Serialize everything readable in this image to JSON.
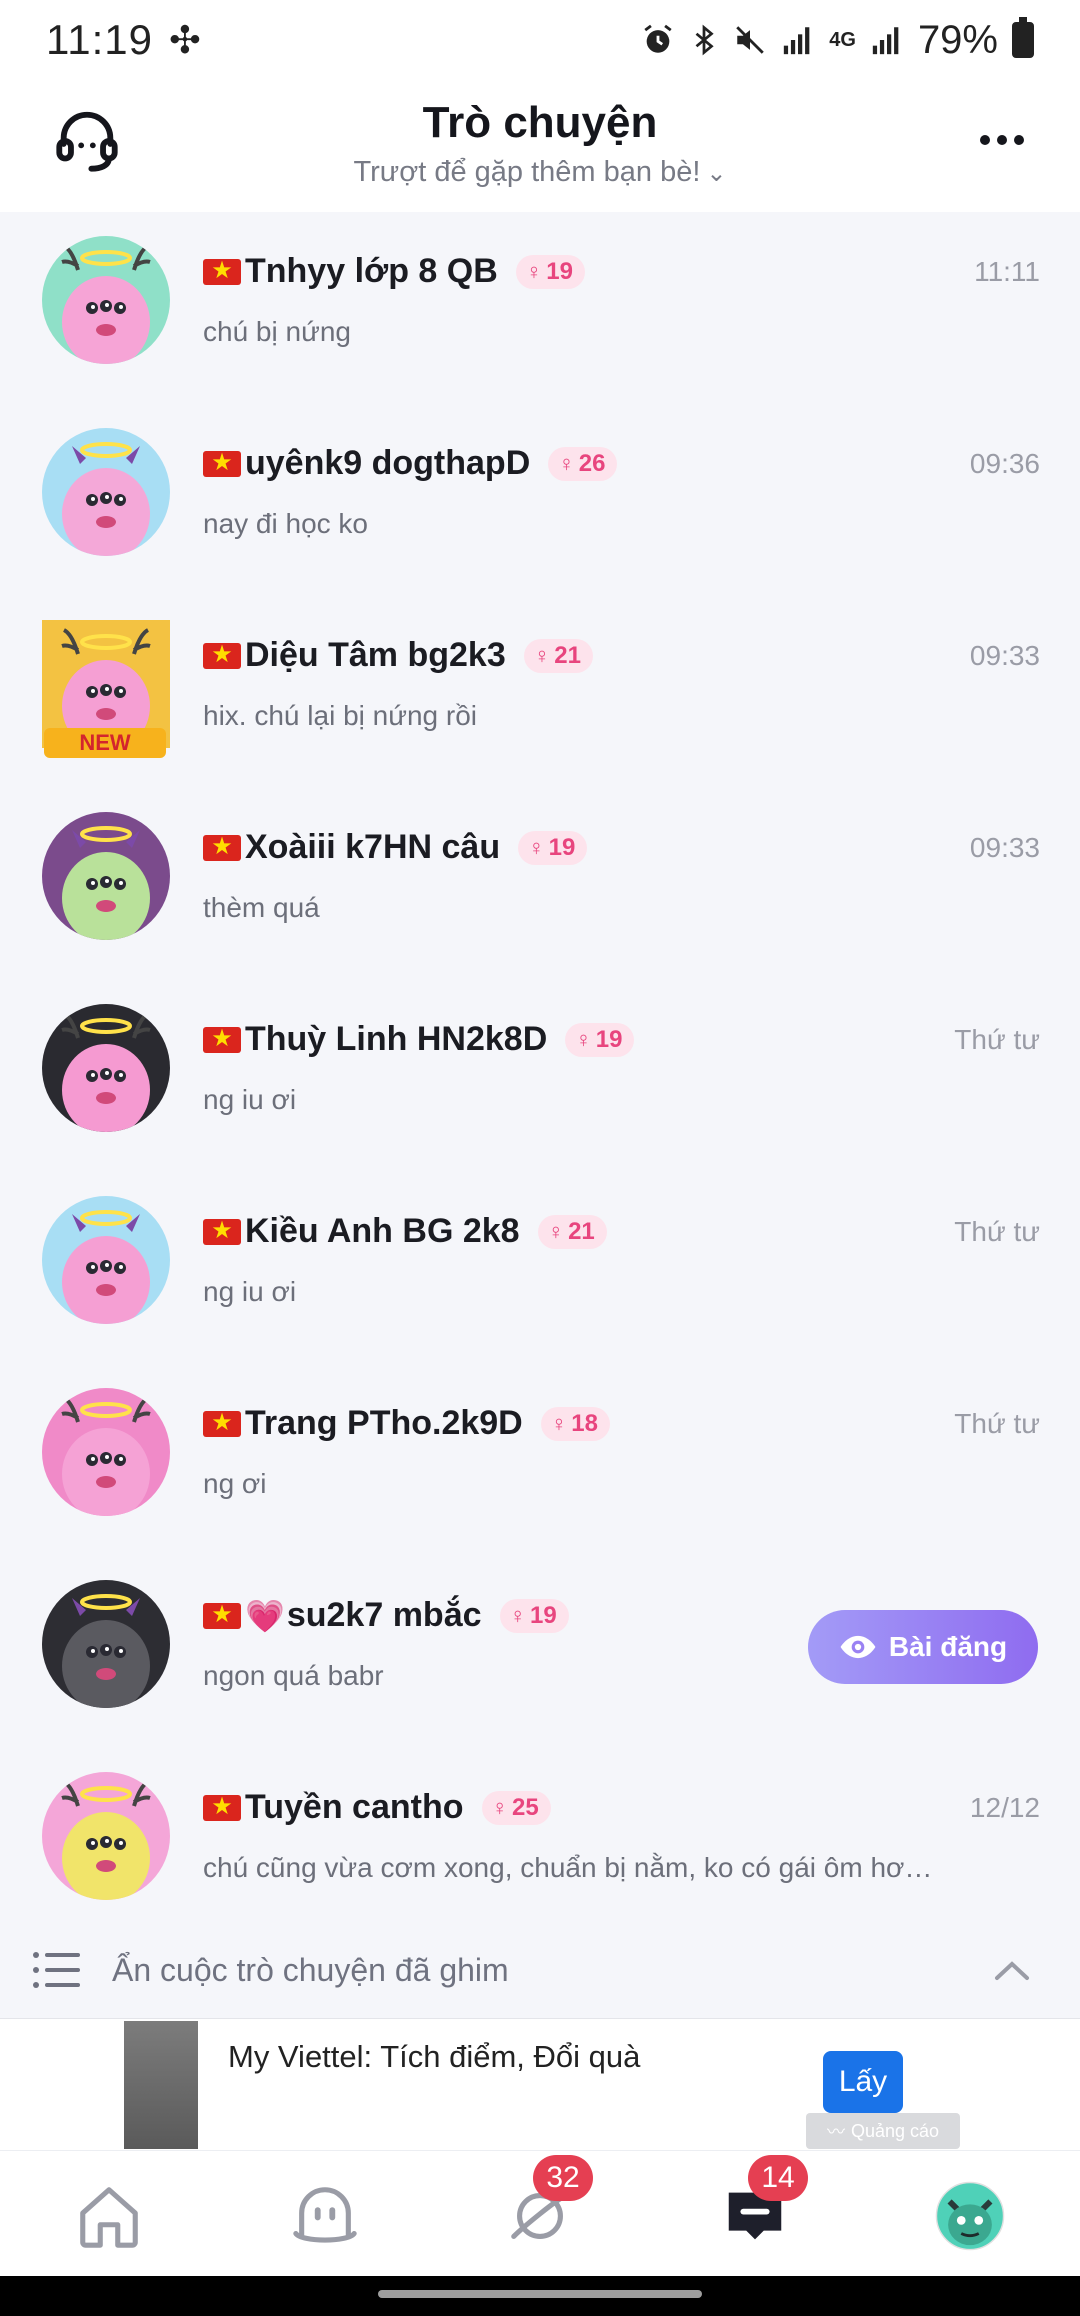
{
  "status_bar": {
    "time": "11:19",
    "pinwheel": "✣",
    "network": "4G",
    "battery": "79%"
  },
  "header": {
    "title": "Trò chuyện",
    "subtitle": "Trượt để gặp thêm bạn bè!",
    "support_icon": "headset-icon",
    "more_icon": "more-dots-icon"
  },
  "chats": [
    {
      "name": "Tnhyy lớp 8 QB",
      "age": "19",
      "time": "11:11",
      "message": "chú bị nứng",
      "avatar_bg": "#8fe0c8",
      "face": "#f6a4d6"
    },
    {
      "name": "uyênk9 dogthapD",
      "age": "26",
      "time": "09:36",
      "message": "nay đi học ko",
      "avatar_bg": "#a8def4",
      "face": "#f4a8d8"
    },
    {
      "name": "Diệu Tâm bg2k3",
      "age": "21",
      "time": "09:33",
      "message": "hix. chú lại bị nứng rồi",
      "avatar_bg": "#f3c242",
      "face": "#f59fd3",
      "new_badge": "NEW"
    },
    {
      "name": "Xoàiii k7HN câu",
      "age": "19",
      "time": "09:33",
      "message": "thèm quá",
      "avatar_bg": "#7b4b8c",
      "face": "#b9e19a"
    },
    {
      "name": "Thuỳ Linh HN2k8D",
      "age": "19",
      "time": "Thứ tư",
      "message": "ng iu ơi",
      "avatar_bg": "#2a2a30",
      "face": "#f59ad1"
    },
    {
      "name": "Kiều Anh BG 2k8",
      "age": "21",
      "time": "Thứ tư",
      "message": "ng iu ơi",
      "avatar_bg": "#a8def4",
      "face": "#f59fd3"
    },
    {
      "name": "Trang PTho.2k9D",
      "age": "18",
      "time": "Thứ tư",
      "message": "ng ơi",
      "avatar_bg": "#f08ac8",
      "face": "#f5a2d5"
    },
    {
      "name": "su2k7 mbắc",
      "age": "19",
      "time": "",
      "message": "ngon quá babr",
      "avatar_bg": "#2d2d33",
      "face": "#5a5a60",
      "heart": "💗",
      "action_label": "Bài đăng"
    },
    {
      "name": "Tuyền cantho",
      "age": "25",
      "time": "12/12",
      "message": "chú cũng vừa cơm xong, chuẩn bị nằm, ko có gái ôm hơi ...",
      "avatar_bg": "#f4a6d8",
      "face": "#f1e46a"
    }
  ],
  "pinned": {
    "label": "Ẩn cuộc trò chuyện đã ghim"
  },
  "ad": {
    "title": "My Viettel: Tích điểm, Đổi quà",
    "button": "Lấy",
    "label": "Quảng cáo"
  },
  "nav": {
    "discover_badge": "32",
    "messages_badge": "14"
  }
}
